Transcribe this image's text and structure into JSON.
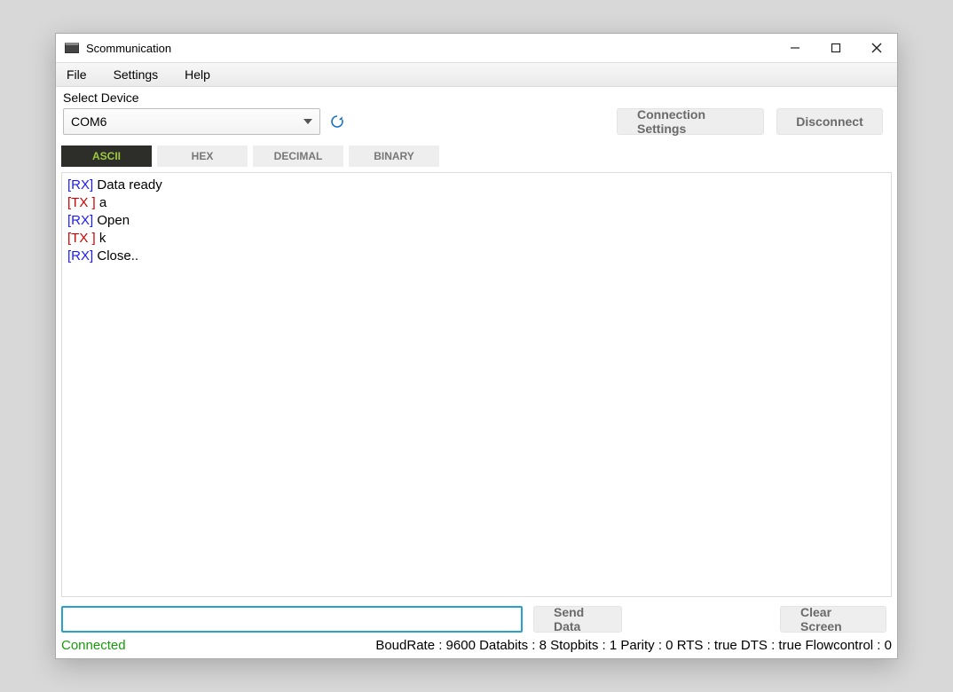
{
  "title": "Scommunication",
  "menu": {
    "file": "File",
    "settings": "Settings",
    "help": "Help"
  },
  "device": {
    "label": "Select Device",
    "value": "COM6"
  },
  "buttons": {
    "connection_settings": "Connection Settings",
    "disconnect": "Disconnect",
    "send_data": "Send Data",
    "clear_screen": "Clear Screen"
  },
  "tabs": {
    "ascii": "ASCII",
    "hex": "HEX",
    "decimal": "DECIMAL",
    "binary": "BINARY"
  },
  "log": [
    {
      "dir": "RX",
      "tag": "[RX]",
      "text": " Data ready"
    },
    {
      "dir": "TX",
      "tag": "[TX ]",
      "text": " a"
    },
    {
      "dir": "RX",
      "tag": "[RX]",
      "text": " Open"
    },
    {
      "dir": "TX",
      "tag": "[TX ]",
      "text": " k"
    },
    {
      "dir": "RX",
      "tag": "[RX]",
      "text": " Close.."
    }
  ],
  "send_value": "",
  "status": {
    "connected": "Connected",
    "info": "BoudRate : 9600 Databits : 8 Stopbits : 1 Parity : 0 RTS : true DTS : true Flowcontrol : 0"
  }
}
